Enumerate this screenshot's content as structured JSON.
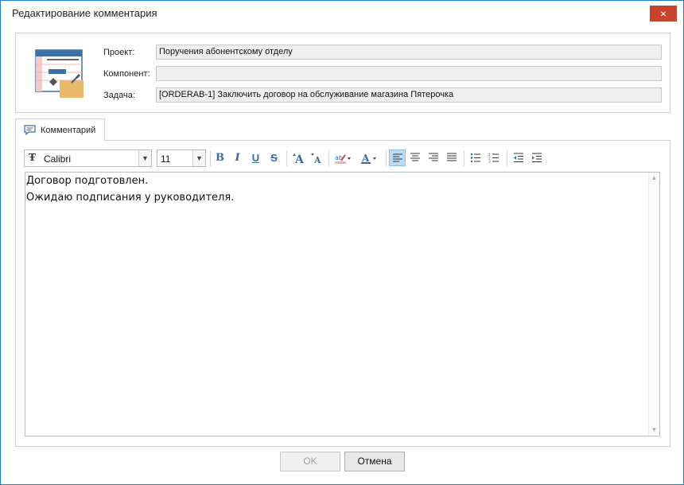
{
  "window": {
    "title": "Редактирование комментария",
    "close_icon": "×"
  },
  "header": {
    "project_label": "Проект:",
    "project_value": "Поручения абонентскому отделу",
    "component_label": "Компонент:",
    "component_value": "",
    "task_label": "Задача:",
    "task_value": "[ORDERAB-1] Заключить договор на обслуживание магазина Пятерочка"
  },
  "tabs": [
    {
      "label": "Комментарий",
      "icon": "comment-icon",
      "active": true
    }
  ],
  "toolbar": {
    "font_icon": "font-family-icon",
    "font_name": "Calibri",
    "font_size": "11",
    "bold": "B",
    "italic": "I",
    "underline": "U",
    "strikethrough": "S",
    "active_alignment": "align-left"
  },
  "editor": {
    "lines": [
      "Договор подготовлен.",
      "Ожидаю подписания у руководителя."
    ]
  },
  "buttons": {
    "ok_label": "OK",
    "cancel_label": "Отмена"
  },
  "colors": {
    "window_border": "#1f7fc6",
    "close_button": "#c7432c",
    "active_toolbar": "#bcdcf5"
  }
}
